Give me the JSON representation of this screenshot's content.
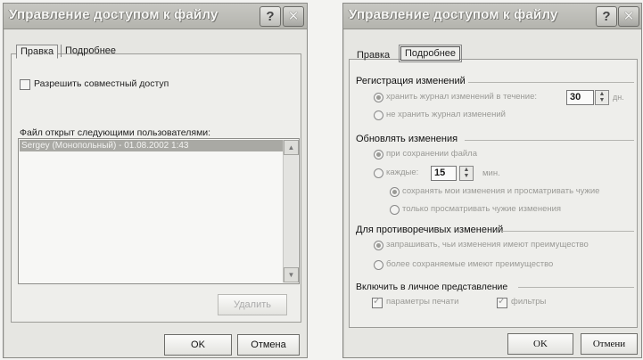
{
  "left": {
    "title": "Управление доступом к файлу",
    "help": "?",
    "close": "✕",
    "tabs": [
      "Правка",
      "Подробнее"
    ],
    "share_checkbox": "Разрешить совместный доступ",
    "users_label": "Файл открыт следующими пользователями:",
    "user_entry": "Sergey (Монопольный) - 01.08.2002 1:43",
    "remove_button": "Удалить",
    "ok": "OK",
    "cancel": "Отмена"
  },
  "right": {
    "title": "Управление доступом к файлу",
    "help": "?",
    "close": "✕",
    "tabs": [
      "Правка",
      "Подробнее"
    ],
    "section_tracking": "Регистрация изменений",
    "keep_log": "хранить журнал изменений в течение:",
    "keep_log_value": "30",
    "days_unit": "дн.",
    "no_log": "не хранить журнал изменений",
    "section_update": "Обновлять изменения",
    "on_save": "при сохранении файла",
    "every": "каждые:",
    "every_value": "15",
    "minutes_unit": "мин.",
    "save_and_view": "сохранять мои изменения и просматривать чужие",
    "only_view": "только просматривать чужие изменения",
    "section_conflict": "Для противоречивых изменений",
    "ask": "запрашивать, чьи изменения имеют преимущество",
    "saved_win": "более сохраняемые имеют преимущество",
    "section_personal": "Включить в личное представление",
    "print_settings": "параметры печати",
    "filters": "фильтры",
    "ok": "OK",
    "cancel": "Отмени"
  }
}
